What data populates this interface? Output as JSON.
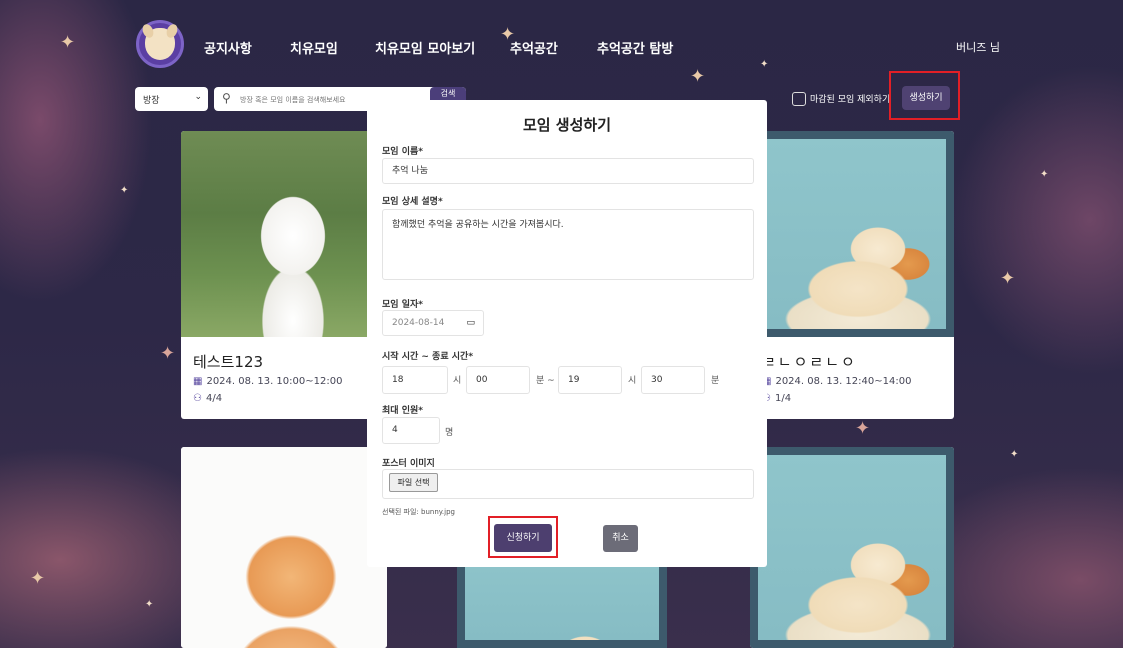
{
  "header": {
    "nav": [
      "공지사항",
      "치유모임",
      "치유모임 모아보기",
      "추억공간",
      "추억공간 탐방"
    ],
    "user": "버니즈 님"
  },
  "search": {
    "select_value": "방장",
    "placeholder": "방장 혹은 모임 이름을 검색해보세요",
    "button": "검색"
  },
  "filters": {
    "exclude_closed_label": "마감된 모임 제외하기",
    "create_button": "생성하기"
  },
  "cards": [
    {
      "title": "테스트123",
      "datetime": "2024. 08. 13. 10:00~12:00",
      "members": "4/4"
    },
    {
      "title": "ㄹㄴㅇㄹㄴㅇ",
      "datetime": "2024. 08. 13. 12:40~14:00",
      "members": "1/4"
    }
  ],
  "modal": {
    "title": "모임 생성하기",
    "name_label": "모임 이름*",
    "name_value": "추억 나눔",
    "desc_label": "모임 상세 설명*",
    "desc_value": "함께했던 추억을 공유하는 시간을 가져봅시다.",
    "date_label": "모임 일자*",
    "date_value": "2024-08-14",
    "time_label": "시작 시간 ~ 종료 시간*",
    "start_hour": "18",
    "start_min": "00",
    "end_hour": "19",
    "end_min": "30",
    "unit_hour": "시",
    "unit_min_tilde": "분 ~",
    "unit_min": "분",
    "max_label": "최대 인원*",
    "max_value": "4",
    "unit_people": "명",
    "poster_label": "포스터 이미지",
    "file_button": "파일 선택",
    "selected_file": "선택된 파일: bunny.jpg",
    "apply_button": "신청하기",
    "cancel_button": "취소"
  },
  "icons": {
    "calendar": "calendar-icon",
    "people": "people-icon",
    "search": "search-icon",
    "chevron": "chevron-down-icon"
  }
}
